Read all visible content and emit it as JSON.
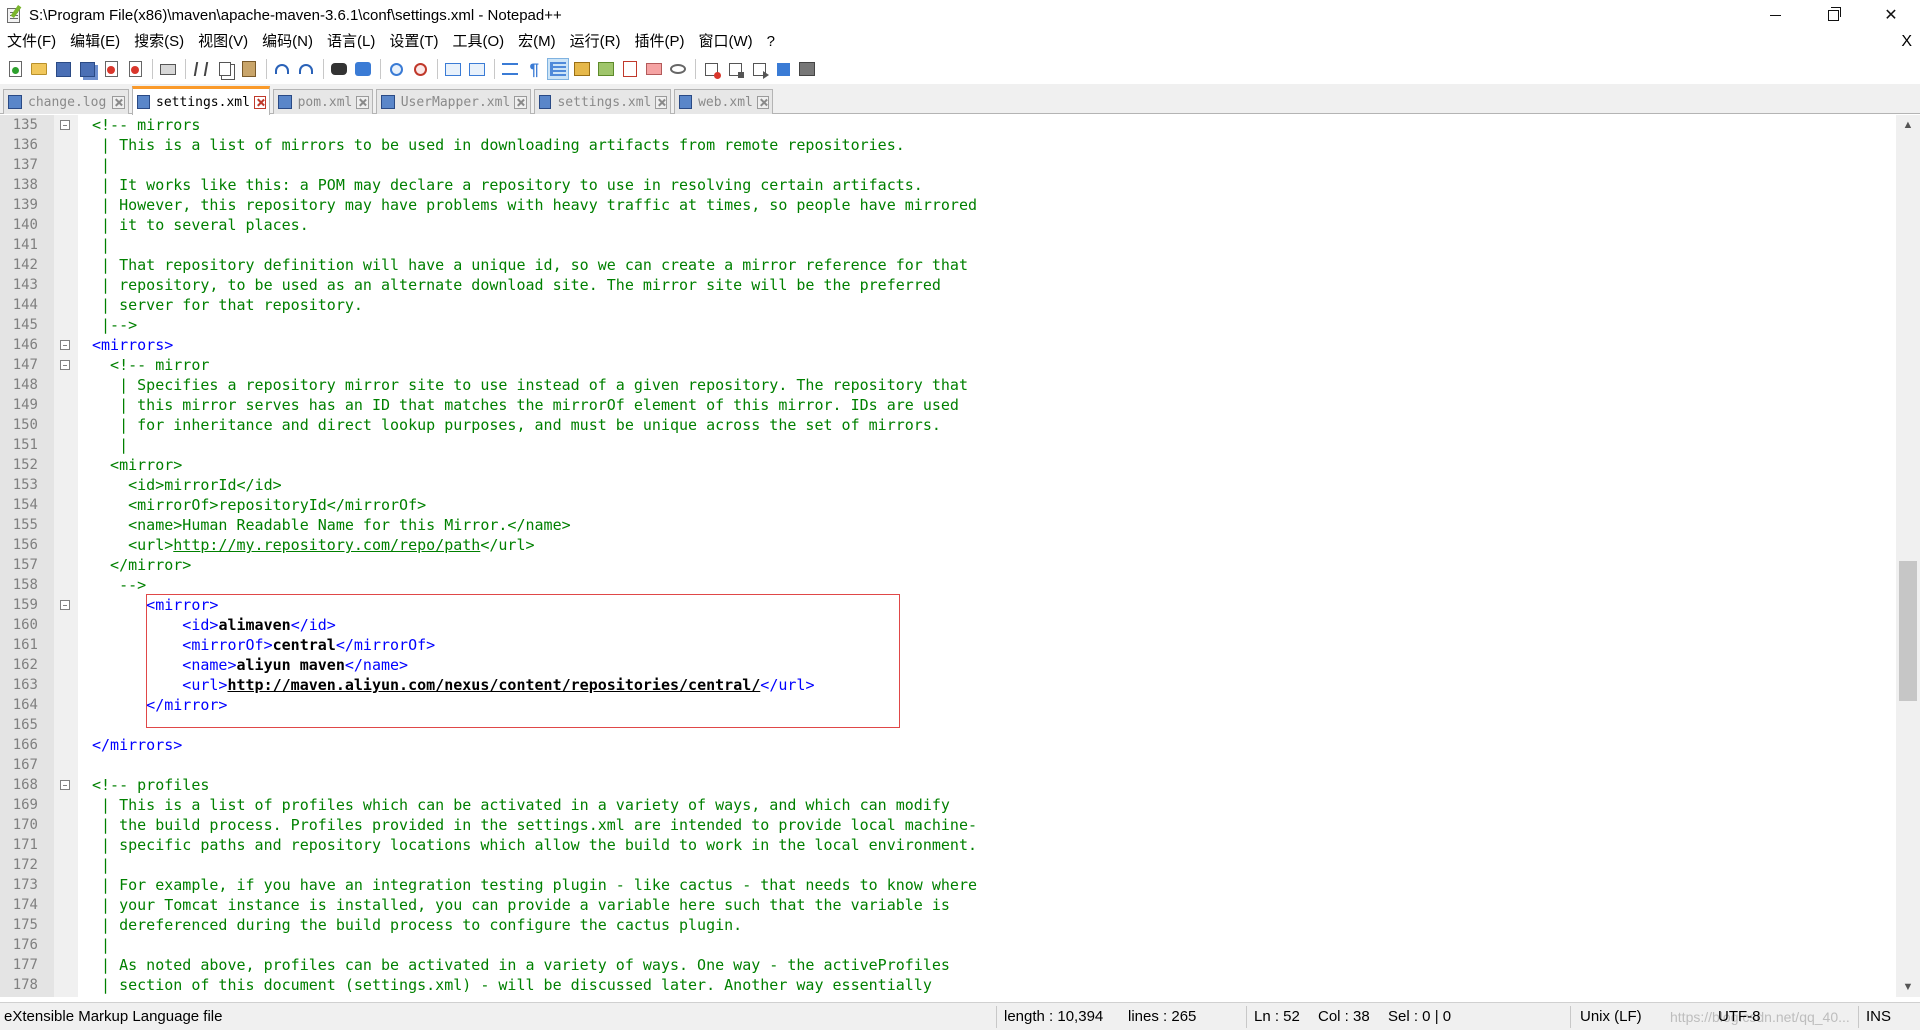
{
  "window": {
    "title": "S:\\Program File(x86)\\maven\\apache-maven-3.6.1\\conf\\settings.xml - Notepad++",
    "controls": {
      "minimize": "—",
      "restore": "❐",
      "close": "✕"
    }
  },
  "menu": {
    "items": [
      "文件(F)",
      "编辑(E)",
      "搜索(S)",
      "视图(V)",
      "编码(N)",
      "语言(L)",
      "设置(T)",
      "工具(O)",
      "宏(M)",
      "运行(R)",
      "插件(P)",
      "窗口(W)",
      "?"
    ],
    "close": "X"
  },
  "toolbar": {
    "icons": [
      "new-file-icon",
      "open-file-icon",
      "save-icon",
      "save-all-icon",
      "close-icon",
      "close-all-icon",
      "print-icon",
      "cut-icon",
      "copy-icon",
      "paste-icon",
      "undo-icon",
      "redo-icon",
      "find-icon",
      "replace-icon",
      "zoom-in-icon",
      "zoom-out-icon",
      "sync-vertical-icon",
      "sync-horizontal-icon",
      "word-wrap-icon",
      "show-all-chars-icon",
      "indent-guide-icon",
      "user-language-icon",
      "document-map-icon",
      "function-list-icon",
      "folder-workspace-icon",
      "monitoring-icon",
      "record-macro-icon",
      "stop-macro-icon",
      "play-macro-icon",
      "run-macro-multiple-icon",
      "save-macro-icon"
    ]
  },
  "tabs": [
    {
      "label": "change.log",
      "active": false
    },
    {
      "label": "settings.xml",
      "active": true
    },
    {
      "label": "pom.xml",
      "active": false
    },
    {
      "label": "UserMapper.xml",
      "active": false
    },
    {
      "label": "settings.xml",
      "active": false
    },
    {
      "label": "web.xml",
      "active": false
    }
  ],
  "editor": {
    "lines": [
      {
        "n": "135",
        "fold": true,
        "parts": [
          {
            "c": "cm",
            "t": "<!-- mirrors"
          }
        ]
      },
      {
        "n": "136",
        "fold": false,
        "parts": [
          {
            "c": "cm",
            "t": " | This is a list of mirrors to be used in downloading artifacts from remote repositories."
          }
        ]
      },
      {
        "n": "137",
        "fold": false,
        "parts": [
          {
            "c": "cm",
            "t": " |"
          }
        ]
      },
      {
        "n": "138",
        "fold": false,
        "parts": [
          {
            "c": "cm",
            "t": " | It works like this: a POM may declare a repository to use in resolving certain artifacts."
          }
        ]
      },
      {
        "n": "139",
        "fold": false,
        "parts": [
          {
            "c": "cm",
            "t": " | However, this repository may have problems with heavy traffic at times, so people have mirrored"
          }
        ]
      },
      {
        "n": "140",
        "fold": false,
        "parts": [
          {
            "c": "cm",
            "t": " | it to several places."
          }
        ]
      },
      {
        "n": "141",
        "fold": false,
        "parts": [
          {
            "c": "cm",
            "t": " |"
          }
        ]
      },
      {
        "n": "142",
        "fold": false,
        "parts": [
          {
            "c": "cm",
            "t": " | That repository definition will have a unique id, so we can create a mirror reference for that"
          }
        ]
      },
      {
        "n": "143",
        "fold": false,
        "parts": [
          {
            "c": "cm",
            "t": " | repository, to be used as an alternate download site. The mirror site will be the preferred"
          }
        ]
      },
      {
        "n": "144",
        "fold": false,
        "parts": [
          {
            "c": "cm",
            "t": " | server for that repository."
          }
        ]
      },
      {
        "n": "145",
        "fold": false,
        "parts": [
          {
            "c": "cm",
            "t": " |-->"
          }
        ]
      },
      {
        "n": "146",
        "fold": true,
        "parts": [
          {
            "c": "tag",
            "t": "<mirrors>"
          }
        ]
      },
      {
        "n": "147",
        "fold": true,
        "parts": [
          {
            "c": "cm",
            "t": "  <!-- mirror"
          }
        ]
      },
      {
        "n": "148",
        "fold": false,
        "parts": [
          {
            "c": "cm",
            "t": "   | Specifies a repository mirror site to use instead of a given repository. The repository that"
          }
        ]
      },
      {
        "n": "149",
        "fold": false,
        "parts": [
          {
            "c": "cm",
            "t": "   | this mirror serves has an ID that matches the mirrorOf element of this mirror. IDs are used"
          }
        ]
      },
      {
        "n": "150",
        "fold": false,
        "parts": [
          {
            "c": "cm",
            "t": "   | for inheritance and direct lookup purposes, and must be unique across the set of mirrors."
          }
        ]
      },
      {
        "n": "151",
        "fold": false,
        "parts": [
          {
            "c": "cm",
            "t": "   |"
          }
        ]
      },
      {
        "n": "152",
        "fold": false,
        "parts": [
          {
            "c": "cm",
            "t": "  <mirror>"
          }
        ]
      },
      {
        "n": "153",
        "fold": false,
        "parts": [
          {
            "c": "cm",
            "t": "    <id>mirrorId</id>"
          }
        ]
      },
      {
        "n": "154",
        "fold": false,
        "parts": [
          {
            "c": "cm",
            "t": "    <mirrorOf>repositoryId</mirrorOf>"
          }
        ]
      },
      {
        "n": "155",
        "fold": false,
        "parts": [
          {
            "c": "cm",
            "t": "    <name>Human Readable Name for this Mirror.</name>"
          }
        ]
      },
      {
        "n": "156",
        "fold": false,
        "parts": [
          {
            "c": "cm",
            "t": "    <url>"
          },
          {
            "c": "cmu",
            "t": "http://my.repository.com/repo/path"
          },
          {
            "c": "cm",
            "t": "</url>"
          }
        ]
      },
      {
        "n": "157",
        "fold": false,
        "parts": [
          {
            "c": "cm",
            "t": "  </mirror>"
          }
        ]
      },
      {
        "n": "158",
        "fold": false,
        "parts": [
          {
            "c": "cm",
            "t": "   -->"
          }
        ]
      },
      {
        "n": "159",
        "fold": true,
        "parts": [
          {
            "c": "tag",
            "t": "      <mirror>"
          }
        ]
      },
      {
        "n": "160",
        "fold": false,
        "parts": [
          {
            "c": "tag",
            "t": "          <id>"
          },
          {
            "c": "bold",
            "t": "alimaven"
          },
          {
            "c": "tag",
            "t": "</id>"
          }
        ]
      },
      {
        "n": "161",
        "fold": false,
        "parts": [
          {
            "c": "tag",
            "t": "          <mirrorOf>"
          },
          {
            "c": "bold",
            "t": "central"
          },
          {
            "c": "tag",
            "t": "</mirrorOf>"
          }
        ]
      },
      {
        "n": "162",
        "fold": false,
        "parts": [
          {
            "c": "tag",
            "t": "          <name>"
          },
          {
            "c": "bold",
            "t": "aliyun maven"
          },
          {
            "c": "tag",
            "t": "</name>"
          }
        ]
      },
      {
        "n": "163",
        "fold": false,
        "parts": [
          {
            "c": "tag",
            "t": "          <url>"
          },
          {
            "c": "bold u",
            "t": "http://maven.aliyun.com/nexus/content/repositories/central/"
          },
          {
            "c": "tag",
            "t": "</url>"
          }
        ]
      },
      {
        "n": "164",
        "fold": false,
        "parts": [
          {
            "c": "tag",
            "t": "      </mirror>"
          }
        ]
      },
      {
        "n": "165",
        "fold": false,
        "parts": [
          {
            "c": "tag",
            "t": ""
          }
        ]
      },
      {
        "n": "166",
        "fold": false,
        "parts": [
          {
            "c": "tag",
            "t": "</mirrors>"
          }
        ]
      },
      {
        "n": "167",
        "fold": false,
        "parts": [
          {
            "c": "tag",
            "t": ""
          }
        ]
      },
      {
        "n": "168",
        "fold": true,
        "parts": [
          {
            "c": "cm",
            "t": "<!-- profiles"
          }
        ]
      },
      {
        "n": "169",
        "fold": false,
        "parts": [
          {
            "c": "cm",
            "t": " | This is a list of profiles which can be activated in a variety of ways, and which can modify"
          }
        ]
      },
      {
        "n": "170",
        "fold": false,
        "parts": [
          {
            "c": "cm",
            "t": " | the build process. Profiles provided in the settings.xml are intended to provide local machine-"
          }
        ]
      },
      {
        "n": "171",
        "fold": false,
        "parts": [
          {
            "c": "cm",
            "t": " | specific paths and repository locations which allow the build to work in the local environment."
          }
        ]
      },
      {
        "n": "172",
        "fold": false,
        "parts": [
          {
            "c": "cm",
            "t": " |"
          }
        ]
      },
      {
        "n": "173",
        "fold": false,
        "parts": [
          {
            "c": "cm",
            "t": " | For example, if you have an integration testing plugin - like cactus - that needs to know where"
          }
        ]
      },
      {
        "n": "174",
        "fold": false,
        "parts": [
          {
            "c": "cm",
            "t": " | your Tomcat instance is installed, you can provide a variable here such that the variable is"
          }
        ]
      },
      {
        "n": "175",
        "fold": false,
        "parts": [
          {
            "c": "cm",
            "t": " | dereferenced during the build process to configure the cactus plugin."
          }
        ]
      },
      {
        "n": "176",
        "fold": false,
        "parts": [
          {
            "c": "cm",
            "t": " |"
          }
        ]
      },
      {
        "n": "177",
        "fold": false,
        "parts": [
          {
            "c": "cm",
            "t": " | As noted above, profiles can be activated in a variety of ways. One way - the activeProfiles"
          }
        ]
      },
      {
        "n": "178",
        "fold": false,
        "parts": [
          {
            "c": "cm",
            "t": " | section of this document (settings.xml) - will be discussed later. Another way essentially"
          }
        ]
      }
    ]
  },
  "statusbar": {
    "filetype": "eXtensible Markup Language file",
    "length": "length : 10,394",
    "lines": "lines : 265",
    "ln": "Ln : 52",
    "col": "Col : 38",
    "sel": "Sel : 0 | 0",
    "eol": "Unix (LF)",
    "watermark": "https://blog.csdn.net/qq_40...",
    "encoding": "UTF-8",
    "mode": "INS"
  },
  "colors": {
    "comment": "#008000",
    "tag": "#0000ff",
    "highlight_border": "#e04848",
    "active_tab_accent": "#fa9a2a"
  }
}
